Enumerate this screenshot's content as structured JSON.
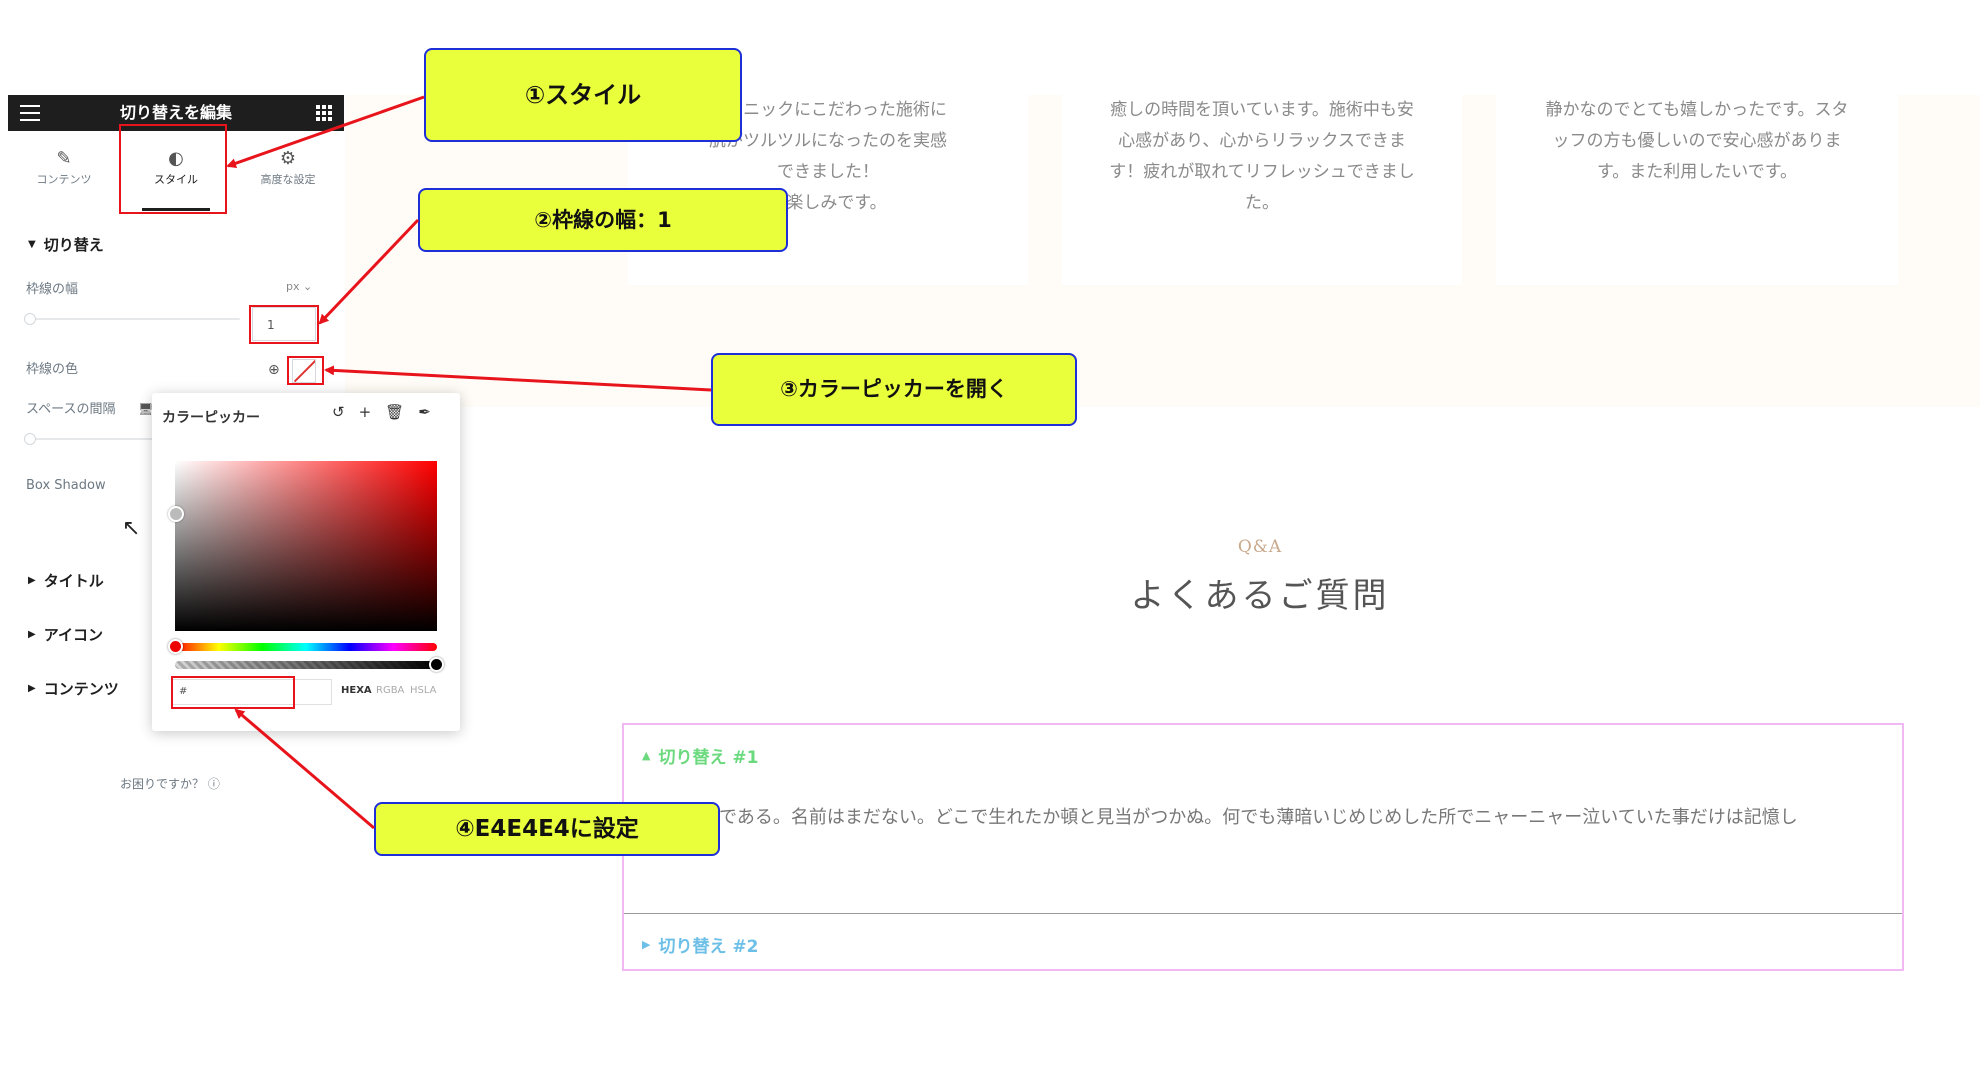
{
  "page": {
    "testimonials": [
      [
        "ーガニックにこだわった施術に",
        "肌がツルツルになったのを実感",
        "できました！",
        "も楽しみです。"
      ],
      [
        "癒しの時間を頂いています。施術中も安",
        "心感があり、心からリラックスできま",
        "す！疲れが取れてリフレッシュできまし",
        "た。"
      ],
      [
        "静かなのでとても嬉しかったです。スタ",
        "ッフの方も優しいので安心感がありま",
        "す。また利用したいです。"
      ]
    ],
    "qa_label": "Q&A",
    "qa_title": "よくあるご質問",
    "accordion": {
      "item1_title": "切り替え #1",
      "item1_body": "である。名前はまだない。どこで生れたか頓と見当がつかぬ。何でも薄暗いじめじめした所でニャーニャー泣いていた事だけは記憶し",
      "item2_title": "切り替え #2"
    }
  },
  "editor": {
    "header_title": "切り替えを編集",
    "tabs": [
      {
        "label": "コンテンツ",
        "icon": "pencil-icon"
      },
      {
        "label": "スタイル",
        "icon": "half-circle-icon"
      },
      {
        "label": "高度な設定",
        "icon": "gear-icon"
      }
    ],
    "sections": {
      "toggle": "切り替え",
      "title": "タイトル",
      "icon": "アイコン",
      "content": "コンテンツ"
    },
    "border_width_label": "枠線の幅",
    "border_width_unit": "px",
    "border_width_value": "1",
    "border_width_fraction": 0.0,
    "border_color_label": "枠線の色",
    "space_label": "スペースの間隔",
    "box_shadow_label": "Box Shadow",
    "help_text": "お困りですか？"
  },
  "color_picker": {
    "title": "カラーピッカー",
    "hex_value": "#",
    "formats": [
      "HEXA",
      "RGBA",
      "HSLA"
    ],
    "active_format": "HEXA"
  },
  "callouts": {
    "c1": "①スタイル",
    "c2": "②枠線の幅：1",
    "c3": "③カラーピッカーを開く",
    "c4": "④E4E4E4に設定"
  },
  "colors": {
    "annotation_red": "#e8141c",
    "callout_fill": "#eaff3c",
    "callout_border": "#1e2fd8",
    "accordion_border": "#f1b8f3",
    "toggle1_green": "#6bd97d",
    "toggle2_blue": "#6cbfe6"
  }
}
